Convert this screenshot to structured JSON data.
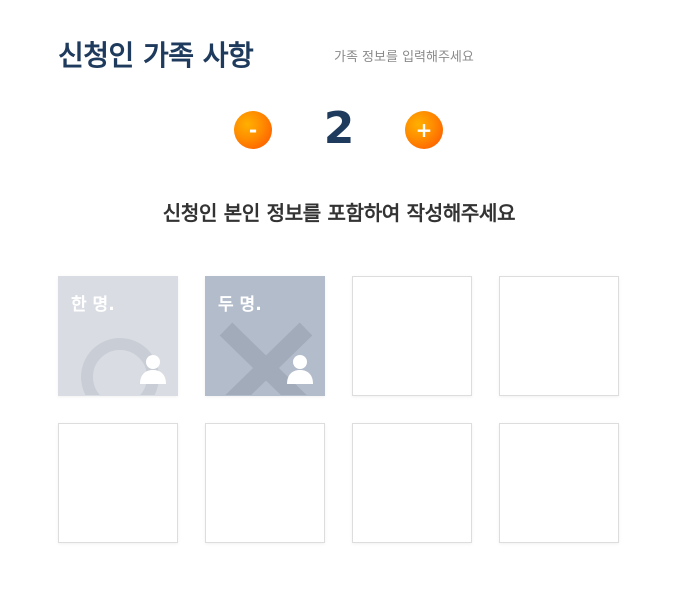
{
  "header": {
    "title": "신청인 가족 사항",
    "subtitle": "가족 정보를 입력해주세요"
  },
  "stepper": {
    "minus_label": "-",
    "value": "2",
    "plus_label": "+",
    "accent_color": "#ff6a00"
  },
  "instruction": "신청인 본인 정보를 포함하여 작성해주세요",
  "members": [
    {
      "label": "한 명.",
      "icon": "person-icon",
      "decoration": "circle"
    },
    {
      "label": "두 명.",
      "icon": "person-icon",
      "decoration": "x"
    },
    {
      "label": ""
    },
    {
      "label": ""
    },
    {
      "label": ""
    },
    {
      "label": ""
    },
    {
      "label": ""
    },
    {
      "label": ""
    }
  ],
  "colors": {
    "title": "#1e3a5c",
    "card_one": "#d9dde3",
    "card_two": "#b3bccb"
  }
}
